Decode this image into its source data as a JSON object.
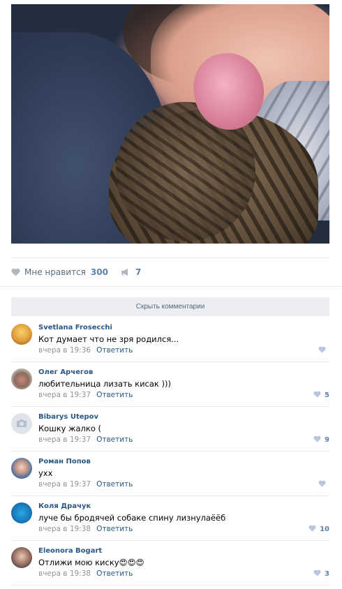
{
  "post": {
    "likes_label": "Мне нравится",
    "likes_count": "300",
    "shares_count": "7"
  },
  "hide_comments_label": "Скрыть комментарии",
  "reply_label": "Ответить",
  "comments": [
    {
      "author": "Svetlana Frosecchi",
      "text": "Кот думает что не зря родился...",
      "time": "вчера в 19:36",
      "likes": ""
    },
    {
      "author": "Олег Арчегов",
      "text": "любительница лизать кисак )))",
      "time": "вчера в 19:37",
      "likes": "5"
    },
    {
      "author": "Bibarys Utepov",
      "text": "Кошку жалко (",
      "time": "вчера в 19:37",
      "likes": "9"
    },
    {
      "author": "Роман Попов",
      "text": "ухх",
      "time": "вчера в 19:37",
      "likes": ""
    },
    {
      "author": "Коля Драчук",
      "text": "луче бы бродячей собаке спину лизнулаёёб",
      "time": "вчера в 19:38",
      "likes": "10"
    },
    {
      "author": "Eleonora Bogart",
      "text": "Отлижи мою киску😍😍😍",
      "time": "вчера в 19:38",
      "likes": "3"
    }
  ]
}
